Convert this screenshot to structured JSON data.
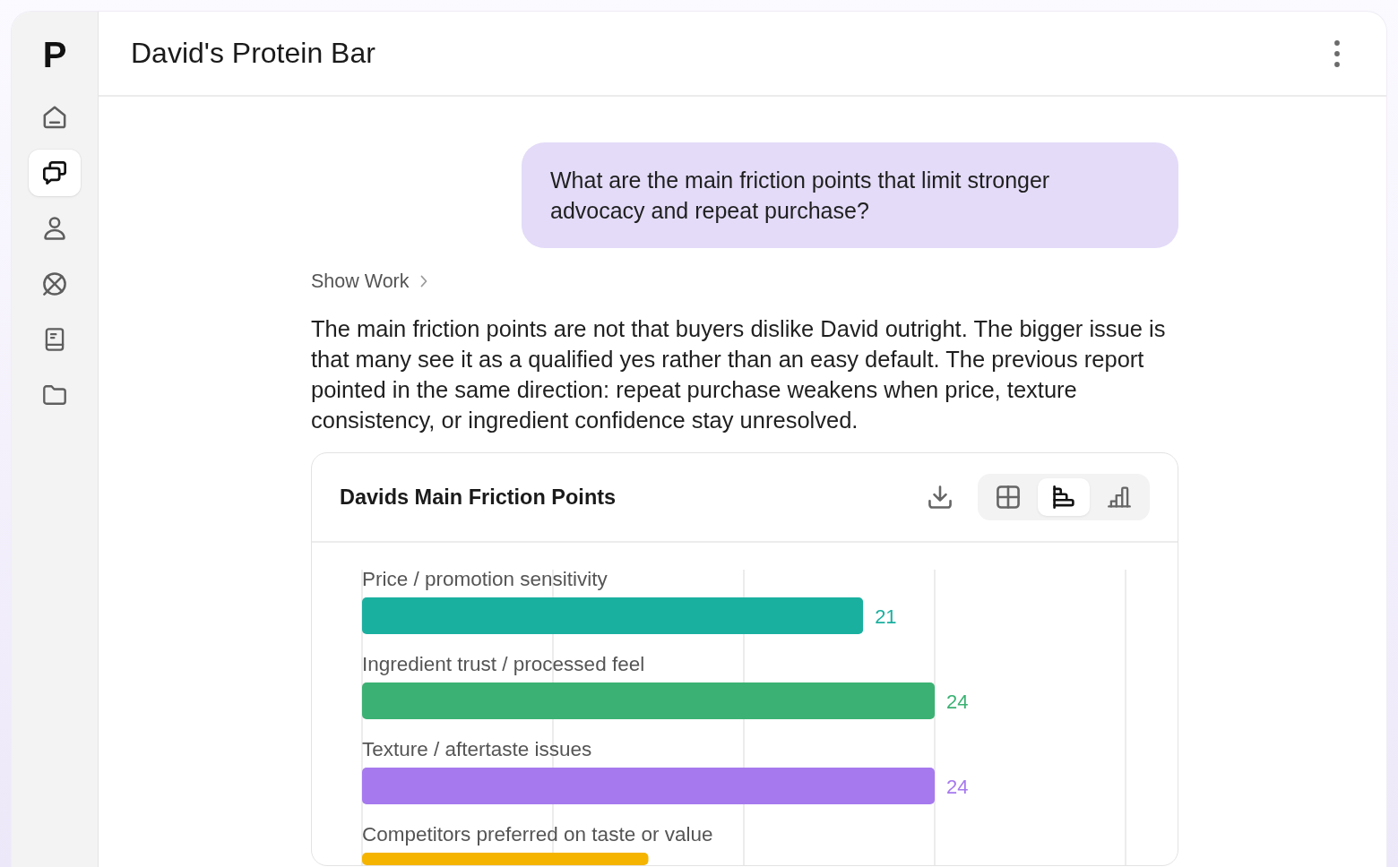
{
  "sidebar": {
    "logo": "P",
    "items": [
      {
        "kind": "home",
        "selected": false
      },
      {
        "kind": "chats",
        "selected": true
      },
      {
        "kind": "person",
        "selected": false
      },
      {
        "kind": "globe",
        "selected": false
      },
      {
        "kind": "book",
        "selected": false
      },
      {
        "kind": "folder",
        "selected": false
      }
    ]
  },
  "header": {
    "title": "David's Protein Bar"
  },
  "conversation": {
    "user_message": "What are the main friction points that limit stronger advocacy and repeat purchase?",
    "show_work": "Show Work",
    "answer": "The main friction points are not that buyers dislike David outright. The bigger issue is that many see it as a qualified yes rather than an easy default. The previous report pointed in the same direction: repeat purchase weakens when price, texture consistency, or ingredient confidence stay unresolved.",
    "chart_card": {
      "title": "Davids Main Friction Points",
      "view_options": [
        {
          "kind": "table",
          "selected": false
        },
        {
          "kind": "horizontal_bar",
          "selected": true
        },
        {
          "kind": "vertical_bar",
          "selected": false
        }
      ],
      "chart_data": {
        "type": "bar",
        "orientation": "horizontal",
        "categories": [
          "Price / promotion sensitivity",
          "Ingredient trust / processed feel",
          "Texture / aftertaste issues",
          "Competitors preferred on taste or value"
        ],
        "values": [
          21,
          24,
          24,
          12
        ],
        "colors": [
          "#1ab0a0",
          "#3bb273",
          "#a679ee",
          "#f5b400"
        ],
        "value_labels": [
          "21",
          "24",
          "24",
          null
        ],
        "xlim": [
          0,
          32
        ],
        "xticks": [
          0,
          8,
          16,
          24,
          32
        ],
        "tick_labels": false,
        "grid": true
      }
    }
  }
}
